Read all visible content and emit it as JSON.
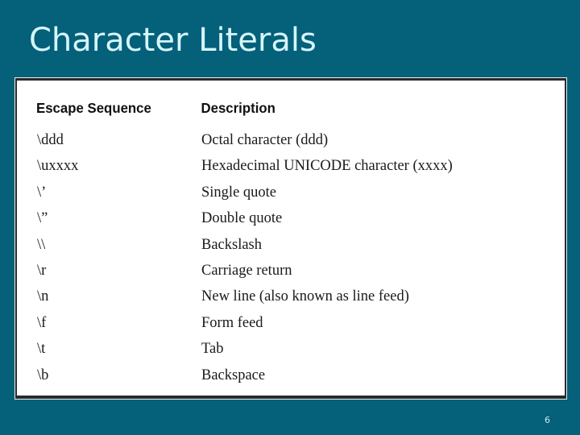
{
  "slide": {
    "title": "Character Literals",
    "page_number": "6",
    "background_color": "#05607a",
    "title_color": "#d6f6fb"
  },
  "table": {
    "headers": {
      "escape_sequence": "Escape Sequence",
      "description": "Description"
    },
    "rows": [
      {
        "sequence": "\\ddd",
        "description": "Octal character (ddd)"
      },
      {
        "sequence": "\\uxxxx",
        "description": "Hexadecimal UNICODE character (xxxx)"
      },
      {
        "sequence": "\\’",
        "description": "Single quote"
      },
      {
        "sequence": "\\”",
        "description": "Double quote"
      },
      {
        "sequence": "\\\\",
        "description": "Backslash"
      },
      {
        "sequence": "\\r",
        "description": "Carriage return"
      },
      {
        "sequence": "\\n",
        "description": "New line (also known as line feed)"
      },
      {
        "sequence": "\\f",
        "description": "Form feed"
      },
      {
        "sequence": "\\t",
        "description": "Tab"
      },
      {
        "sequence": "\\b",
        "description": "Backspace"
      }
    ]
  }
}
